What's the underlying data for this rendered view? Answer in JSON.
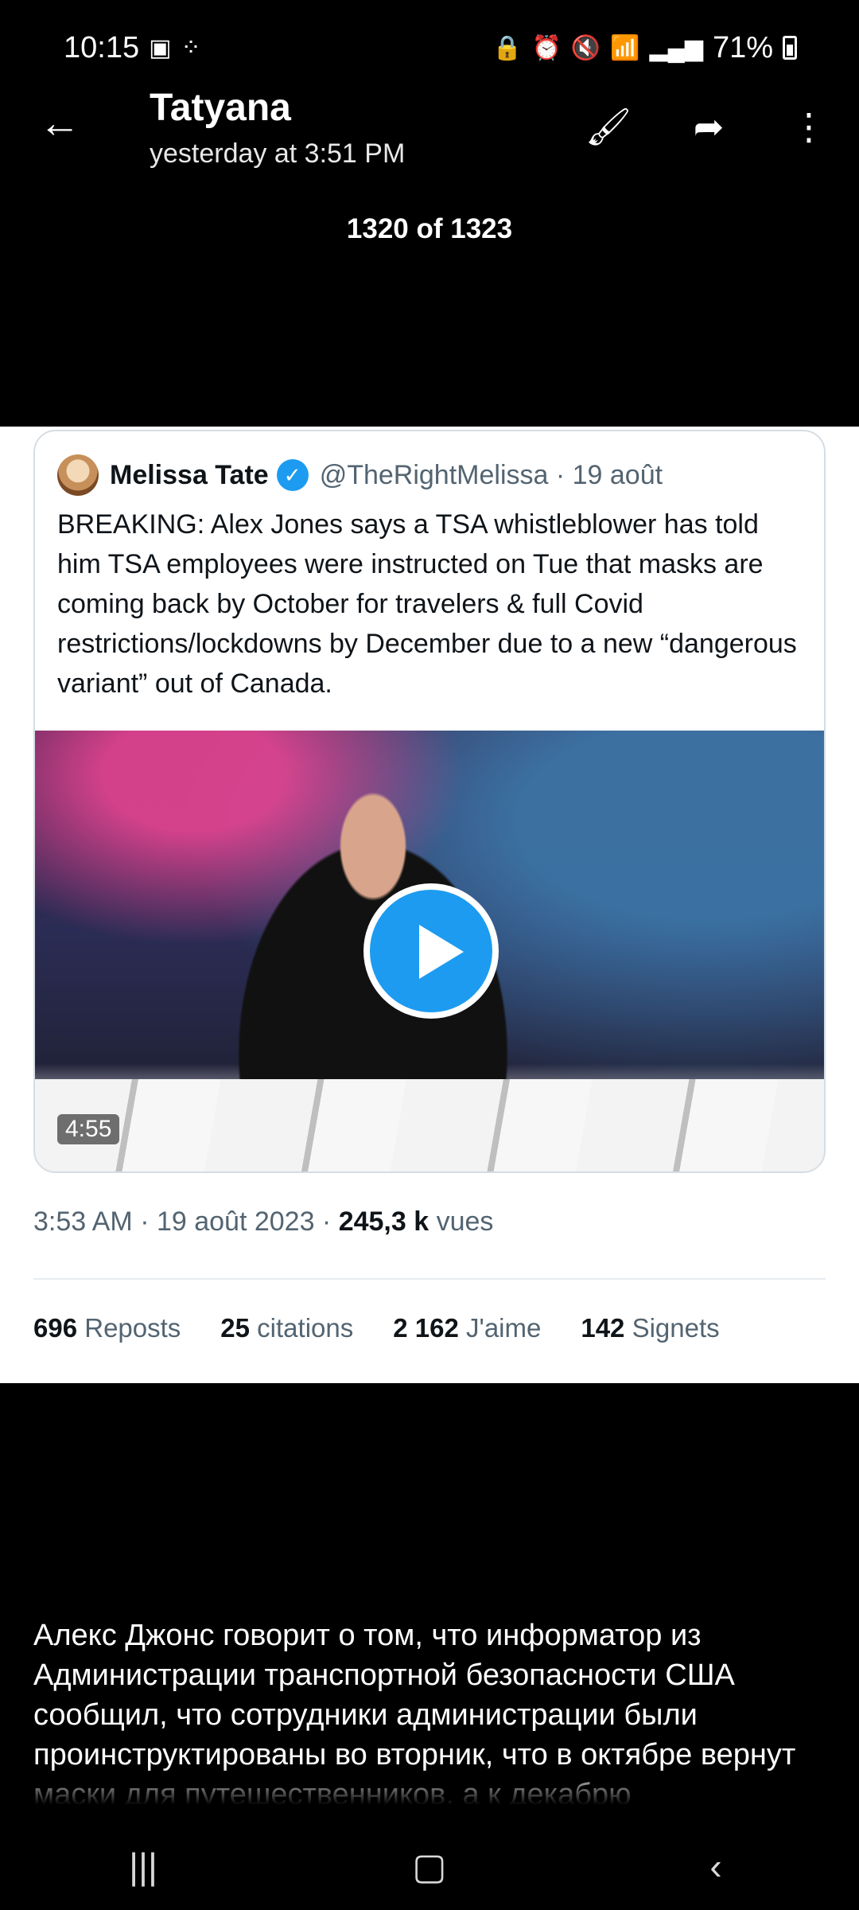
{
  "status_bar": {
    "time": "10:15",
    "battery": "71%",
    "left_icons": [
      "notification-icon",
      "transfer-icon"
    ],
    "right_icons": [
      "lock-icon",
      "alarm-icon",
      "mute-icon",
      "wifi-icon",
      "signal-icon",
      "battery-icon"
    ]
  },
  "header": {
    "title": "Tatyana",
    "subtitle": "yesterday at 3:51 PM",
    "counter": "1320 of 1323"
  },
  "tweet": {
    "author_name": "Melissa Tate",
    "author_handle": "@TheRightMelissa · 19 août",
    "text": "BREAKING: Alex Jones says a TSA whistleblower has told him TSA employees were instructed on Tue that masks are coming back by October for travelers & full Covid restrictions/lockdowns by December due to a new “dangerous variant” out of Canada.",
    "video_duration": "4:55",
    "meta_time": "3:53 AM · 19 août 2023 · ",
    "views_value": "245,3 k",
    "views_label": " vues",
    "stats": [
      {
        "value": "696",
        "label": " Reposts"
      },
      {
        "value": "25",
        "label": " citations"
      },
      {
        "value": "2 162",
        "label": " J'aime"
      },
      {
        "value": "142",
        "label": " Signets"
      }
    ]
  },
  "caption": "Алекс Джонс говорит о том, что информатор из Администрации транспортной безопасности США сообщил, что сотрудники администрации были проинструктированы во вторник, что в октябре вернут маски для путешественников, а к декабрю"
}
